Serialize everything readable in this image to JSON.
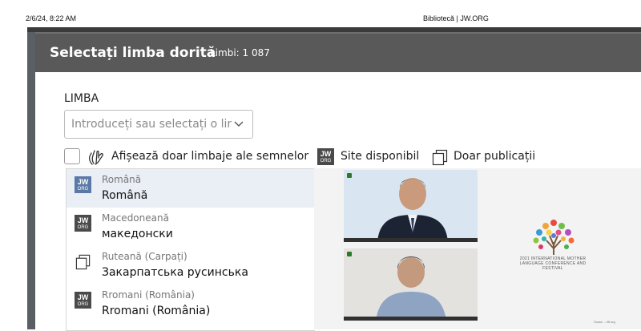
{
  "print_header": {
    "date": "2/6/24, 8:22 AM",
    "title": "Bibliotecă | JW.ORG"
  },
  "modal": {
    "title": "Selectați limba dorită",
    "count": "Limbi: 1 087",
    "field_label": "LIMBA",
    "search": {
      "placeholder": "Introduceți sau selectați o lim",
      "value": ""
    },
    "filters": {
      "sign_language_label": "Afișează doar limbaje ale semnelor",
      "sign_language_checked": false,
      "site_available_label": "Site disponibil",
      "publications_only_label": "Doar publicații"
    },
    "languages": [
      {
        "name": "Română",
        "native": "Română",
        "icon": "jw-org-logo",
        "selected": true
      },
      {
        "name": "Macedoneană",
        "native": "македонски",
        "icon": "jw-org-logo",
        "selected": false
      },
      {
        "name": "Ruteană (Carpați)",
        "native": "Закарпатська русинська",
        "icon": "publications-icon",
        "selected": false
      },
      {
        "name": "Rromani (România)",
        "native": "Rromani (România)",
        "icon": "jw-org-logo",
        "selected": false
      }
    ]
  },
  "logo": {
    "jw": "JW",
    "org": "ORG"
  },
  "background_video": {
    "festival_text": "2021 INTERNATIONAL MOTHER LANGUAGE CONFERENCE AND FESTIVAL",
    "credit": "Sursa: .../ifl.org"
  },
  "colors": {
    "modal_header": "#595959",
    "selected_row": "#eaeef5",
    "jw_logo_dark": "#4a4a4a",
    "jw_logo_blue": "#5a79a6"
  }
}
